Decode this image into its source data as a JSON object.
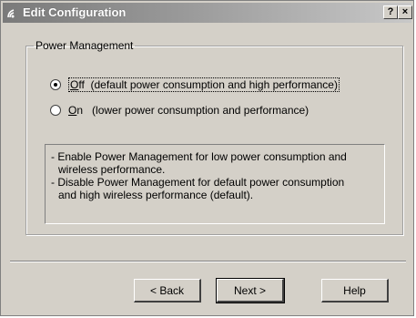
{
  "window": {
    "title": "Edit Configuration",
    "icon": "wireless-icon",
    "help_button": "?",
    "close_button": "×"
  },
  "power_management": {
    "group_label": "Power Management",
    "options": [
      {
        "accel": "O",
        "rest": "ff",
        "description": "(default power consumption and high performance)",
        "selected": true
      },
      {
        "accel": "O",
        "rest": "n",
        "description": "(lower power consumption and performance)",
        "selected": false
      }
    ],
    "description_lines": [
      "- Enable Power Management for low power consumption and",
      "  wireless performance.",
      "- Disable Power Management for default power consumption",
      "  and high wireless performance (default)."
    ]
  },
  "buttons": {
    "back_label": "< Back",
    "next_label": "Next >",
    "help_label": "Help"
  },
  "colors": {
    "dialog_bg": "#d4d0c8",
    "titlebar_start": "#7a7a7a",
    "titlebar_end": "#c8c8c8"
  }
}
